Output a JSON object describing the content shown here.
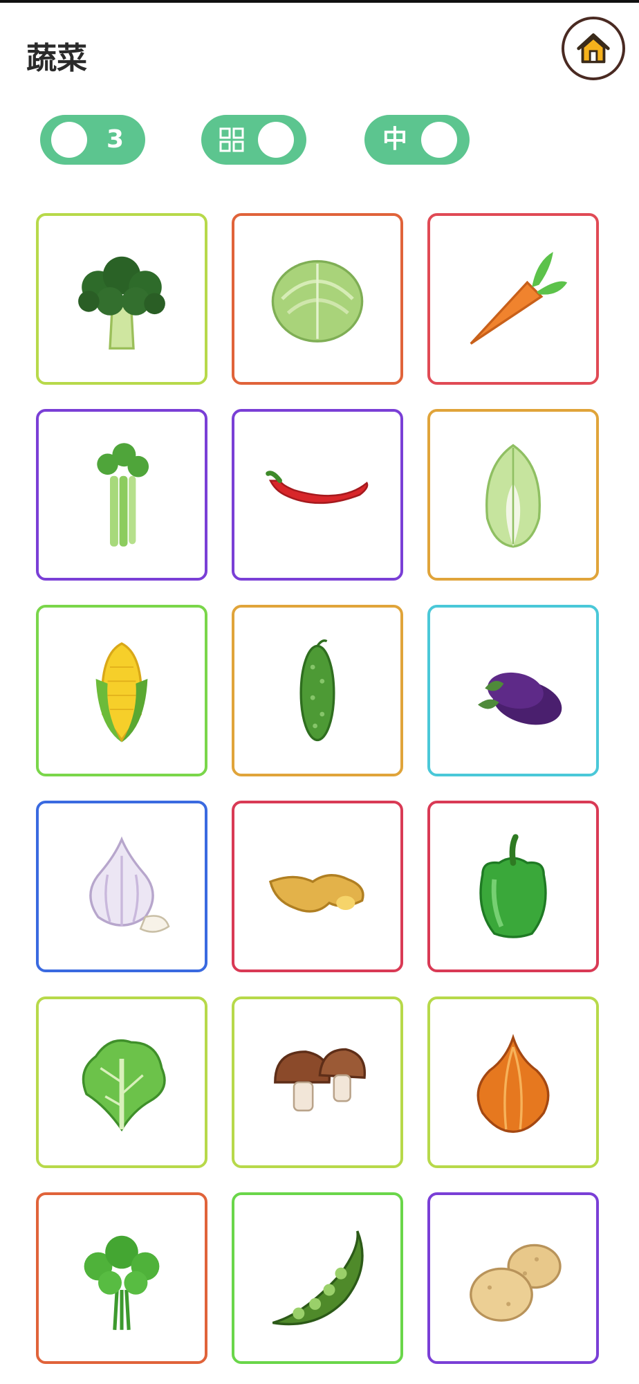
{
  "header": {
    "title": "蔬菜",
    "home_icon": "home-icon"
  },
  "controls": {
    "count": "3",
    "grid_icon": "grid-icon",
    "size": "中",
    "accent": "#5cc58f"
  },
  "cards": [
    {
      "name": "broccoli",
      "border": "#b7d94a"
    },
    {
      "name": "cabbage",
      "border": "#e0633a"
    },
    {
      "name": "carrot",
      "border": "#e04a55"
    },
    {
      "name": "celery",
      "border": "#7a3fd6"
    },
    {
      "name": "chili-pepper",
      "border": "#7a3fd6"
    },
    {
      "name": "napa-cabbage",
      "border": "#e0a43a"
    },
    {
      "name": "corn",
      "border": "#7ad64a"
    },
    {
      "name": "cucumber",
      "border": "#e0a43a"
    },
    {
      "name": "eggplant",
      "border": "#4ac8d8"
    },
    {
      "name": "garlic",
      "border": "#3a6ae0"
    },
    {
      "name": "ginger",
      "border": "#d93a55"
    },
    {
      "name": "green-pepper",
      "border": "#d93a55"
    },
    {
      "name": "lettuce",
      "border": "#b7d94a"
    },
    {
      "name": "mushroom",
      "border": "#b7d94a"
    },
    {
      "name": "onion",
      "border": "#b7d94a"
    },
    {
      "name": "cilantro",
      "border": "#e0633a"
    },
    {
      "name": "pea-pod",
      "border": "#6ad64a"
    },
    {
      "name": "potato",
      "border": "#7a3fd6"
    }
  ]
}
